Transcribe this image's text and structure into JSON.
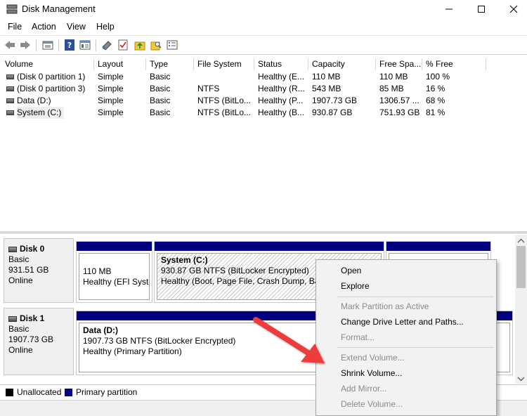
{
  "window": {
    "title": "Disk Management"
  },
  "menu": [
    "File",
    "Action",
    "View",
    "Help"
  ],
  "columns": [
    "Volume",
    "Layout",
    "Type",
    "File System",
    "Status",
    "Capacity",
    "Free Spa...",
    "% Free"
  ],
  "volumes": [
    {
      "name": "(Disk 0 partition 1)",
      "layout": "Simple",
      "type": "Basic",
      "fs": "",
      "status": "Healthy (E...",
      "capacity": "110 MB",
      "free": "110 MB",
      "pct": "100 %"
    },
    {
      "name": "(Disk 0 partition 3)",
      "layout": "Simple",
      "type": "Basic",
      "fs": "NTFS",
      "status": "Healthy (R...",
      "capacity": "543 MB",
      "free": "85 MB",
      "pct": "16 %"
    },
    {
      "name": "Data (D:)",
      "layout": "Simple",
      "type": "Basic",
      "fs": "NTFS (BitLo...",
      "status": "Healthy (P...",
      "capacity": "1907.73 GB",
      "free": "1306.57 ...",
      "pct": "68 %"
    },
    {
      "name": "System (C:)",
      "layout": "Simple",
      "type": "Basic",
      "fs": "NTFS (BitLo...",
      "status": "Healthy (B...",
      "capacity": "930.87 GB",
      "free": "751.93 GB",
      "pct": "81 %"
    }
  ],
  "disks": [
    {
      "name": "Disk 0",
      "type": "Basic",
      "size": "931.51 GB",
      "state": "Online",
      "partitions": [
        {
          "size": "110 MB",
          "status": "Healthy (EFI System Partition)"
        },
        {
          "name": "System  (C:)",
          "size": "930.87 GB NTFS (BitLocker Encrypted)",
          "status": "Healthy (Boot, Page File, Crash Dump, Basic Data Partition)"
        }
      ]
    },
    {
      "name": "Disk 1",
      "type": "Basic",
      "size": "1907.73 GB",
      "state": "Online",
      "partitions": [
        {
          "name": "Data  (D:)",
          "size": "1907.73 GB NTFS (BitLocker Encrypted)",
          "status": "Healthy (Primary Partition)"
        }
      ]
    }
  ],
  "legend": [
    {
      "label": "Unallocated",
      "color": "#000000"
    },
    {
      "label": "Primary partition",
      "color": "#000080"
    }
  ],
  "context_menu": [
    {
      "label": "Open",
      "enabled": true
    },
    {
      "label": "Explore",
      "enabled": true
    },
    {
      "label": "Mark Partition as Active",
      "enabled": false
    },
    {
      "label": "Change Drive Letter and Paths...",
      "enabled": true
    },
    {
      "label": "Format...",
      "enabled": false
    },
    {
      "label": "Extend Volume...",
      "enabled": false
    },
    {
      "label": "Shrink Volume...",
      "enabled": true
    },
    {
      "label": "Add Mirror...",
      "enabled": false
    },
    {
      "label": "Delete Volume...",
      "enabled": false
    }
  ],
  "icons": [
    "back-icon",
    "forward-icon",
    "up-icon",
    "help-icon",
    "properties-icon",
    "connect-icon",
    "check-icon",
    "folder-up-icon",
    "search-folder-icon",
    "list-icon"
  ]
}
